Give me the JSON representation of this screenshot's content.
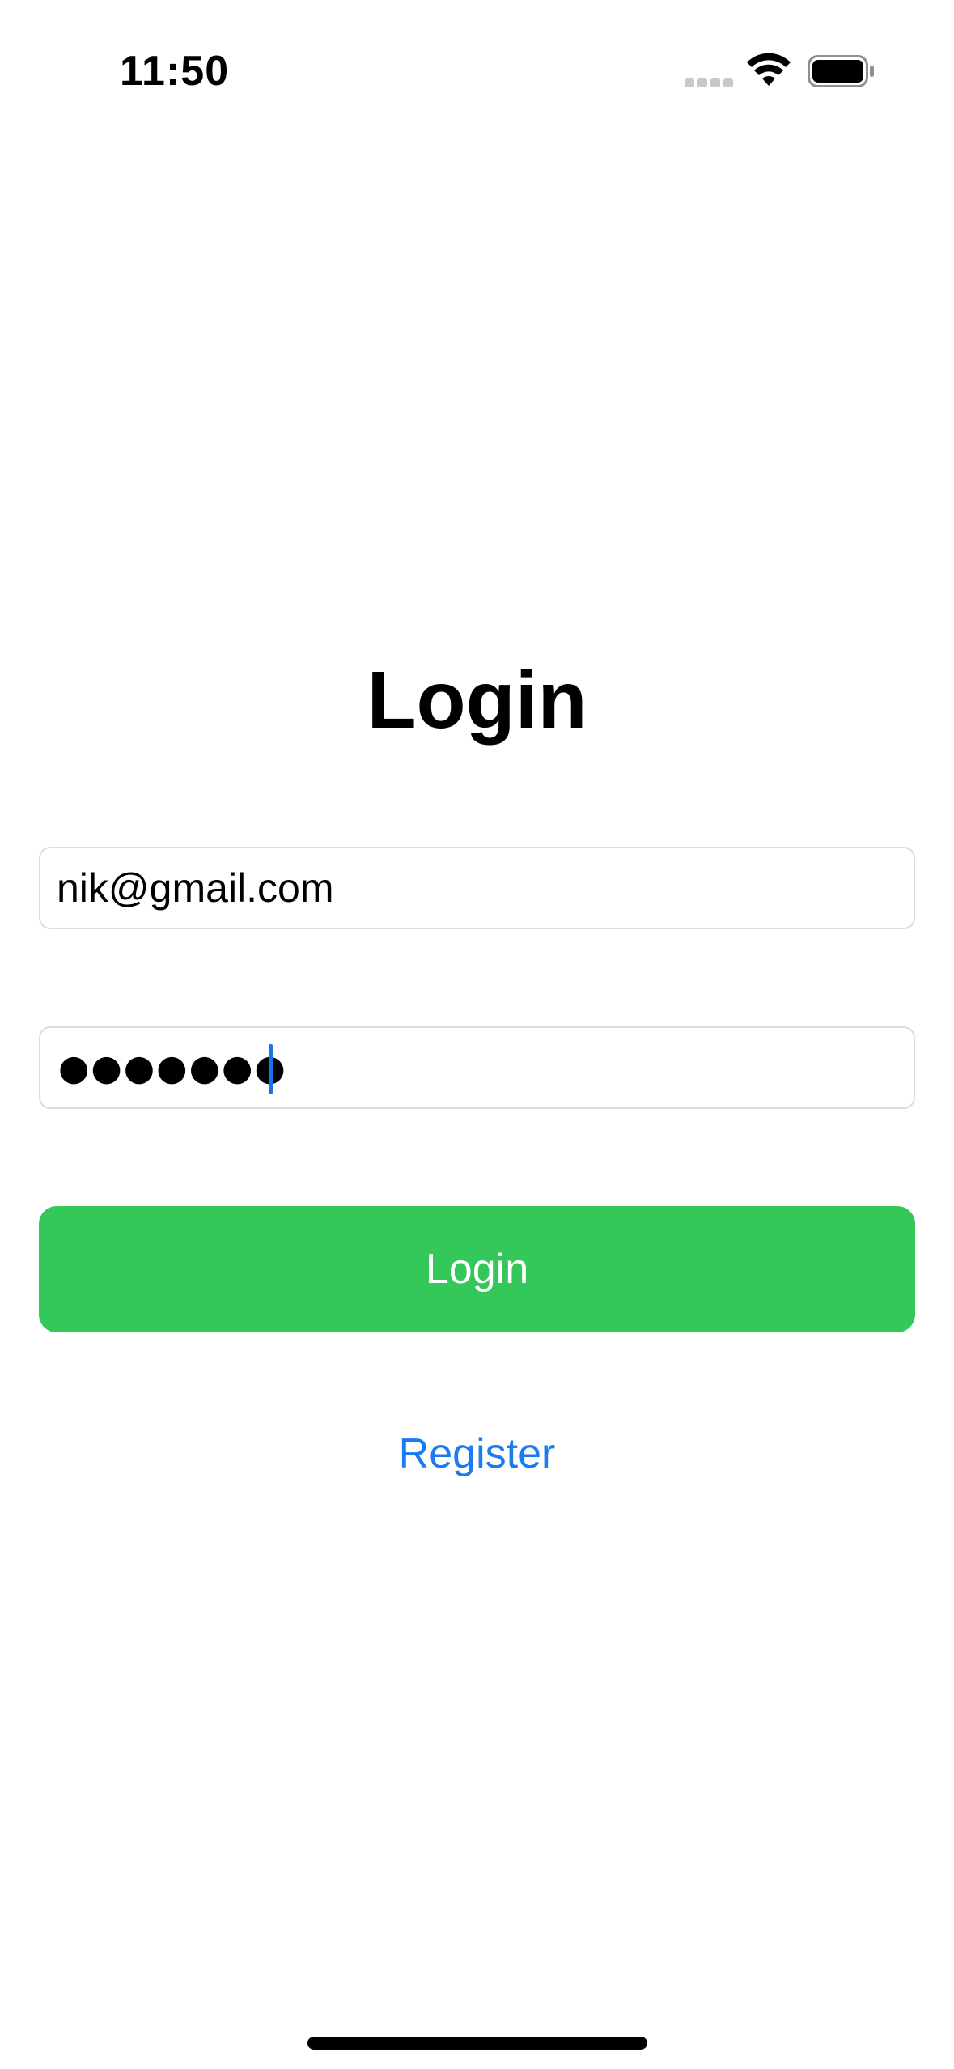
{
  "status_bar": {
    "time": "11:50",
    "signal_icon": "cellular-signal-icon",
    "wifi_icon": "wifi-icon",
    "battery_icon": "battery-icon"
  },
  "page": {
    "title": "Login"
  },
  "form": {
    "email_value": "nik@gmail.com",
    "password_masked": "●●●●●●●",
    "login_button_label": "Login",
    "register_link_label": "Register"
  },
  "colors": {
    "login_button": "#34c759",
    "register_link": "#1a7cf0",
    "cursor": "#1a73e8",
    "field_border": "#dcdcdc"
  }
}
